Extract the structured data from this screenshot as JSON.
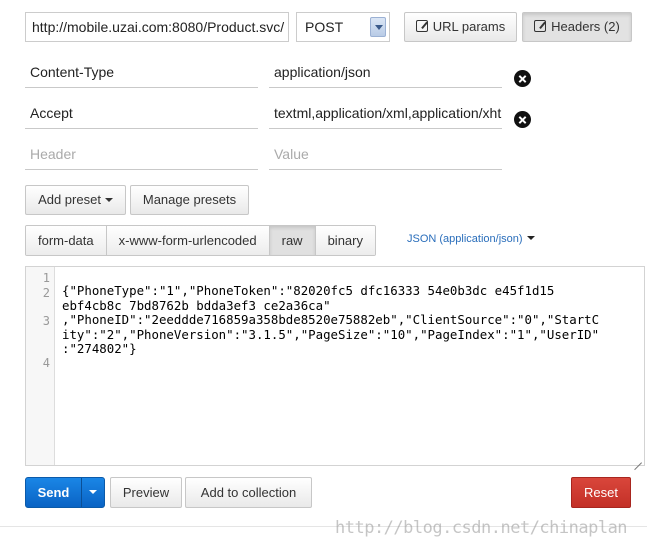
{
  "request": {
    "url": "http://mobile.uzai.com:8080/Product.svc/",
    "method": "POST",
    "url_params_label": "URL params",
    "headers_label": "Headers (2)"
  },
  "headers": [
    {
      "key": "Content-Type",
      "value": "application/json"
    },
    {
      "key": "Accept",
      "value": "textml,application/xml,application/xhtml+xml"
    }
  ],
  "new_header": {
    "key_placeholder": "Header",
    "value_placeholder": "Value"
  },
  "presets": {
    "add_label": "Add preset",
    "manage_label": "Manage presets"
  },
  "body_tabs": {
    "form_data": "form-data",
    "urlencoded": "x-www-form-urlencoded",
    "raw": "raw",
    "binary": "binary"
  },
  "raw_type": "JSON (application/json)",
  "editor": {
    "line_numbers": [
      "1",
      "2",
      "3",
      "4"
    ],
    "lines": [
      "{\"PhoneType\":\"1\",\"PhoneToken\":\"82020fc5 dfc16333 54e0b3dc e45f1d15",
      "ebf4cb8c 7bd8762b bdda3ef3 ce2a36ca\"",
      ",\"PhoneID\":\"2eeddde716859a358bde8520e75882eb\",\"ClientSource\":\"0\",\"StartC",
      "ity\":\"2\",\"PhoneVersion\":\"3.1.5\",\"PageSize\":\"10\",\"PageIndex\":\"1\",\"UserID\"",
      ":\"274802\"}"
    ]
  },
  "actions": {
    "send": "Send",
    "preview": "Preview",
    "add_to_collection": "Add to collection",
    "reset": "Reset"
  },
  "watermark": "http://blog.csdn.net/chinaplan",
  "colors": {
    "send": "#0a63c4",
    "reset": "#c33027",
    "link": "#2a6ebb"
  }
}
